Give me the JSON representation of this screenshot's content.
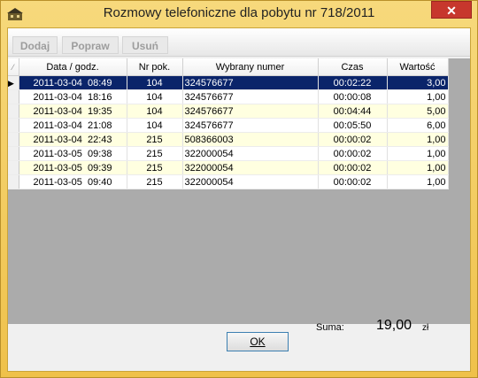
{
  "window": {
    "title": "Rozmowy telefoniczne dla pobytu nr 718/2011",
    "close_label": "✕"
  },
  "toolbar": {
    "add_label": "Dodaj",
    "edit_label": "Popraw",
    "delete_label": "Usuń"
  },
  "grid": {
    "columns": [
      "Data / godz.",
      "Nr pok.",
      "Wybrany numer",
      "Czas",
      "Wartość"
    ],
    "rows": [
      {
        "date": "2011-03-04  08:49",
        "room": "104",
        "number": "324576677",
        "time": "00:02:22",
        "value": "3,00"
      },
      {
        "date": "2011-03-04  18:16",
        "room": "104",
        "number": "324576677",
        "time": "00:00:08",
        "value": "1,00"
      },
      {
        "date": "2011-03-04  19:35",
        "room": "104",
        "number": "324576677",
        "time": "00:04:44",
        "value": "5,00"
      },
      {
        "date": "2011-03-04  21:08",
        "room": "104",
        "number": "324576677",
        "time": "00:05:50",
        "value": "6,00"
      },
      {
        "date": "2011-03-04  22:43",
        "room": "215",
        "number": "508366003",
        "time": "00:00:02",
        "value": "1,00"
      },
      {
        "date": "2011-03-05  09:38",
        "room": "215",
        "number": "322000054",
        "time": "00:00:02",
        "value": "1,00"
      },
      {
        "date": "2011-03-05  09:39",
        "room": "215",
        "number": "322000054",
        "time": "00:00:02",
        "value": "1,00"
      },
      {
        "date": "2011-03-05  09:40",
        "room": "215",
        "number": "322000054",
        "time": "00:00:02",
        "value": "1,00"
      }
    ]
  },
  "summary": {
    "label": "Suma:",
    "value": "19,00",
    "unit": "zł"
  },
  "buttons": {
    "ok_label": "OK"
  }
}
